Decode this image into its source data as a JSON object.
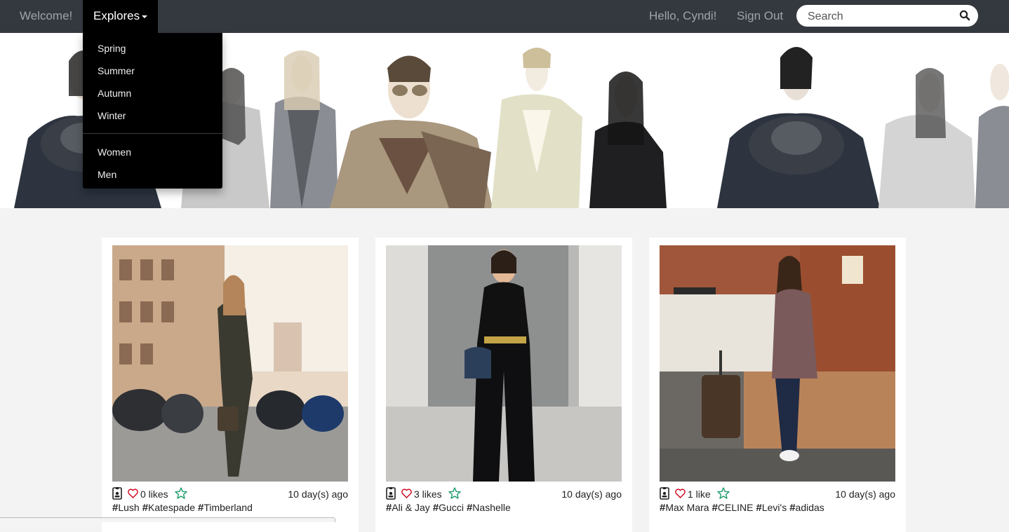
{
  "nav": {
    "welcome": "Welcome!",
    "explores": "Explores",
    "greeting": "Hello, Cyndi!",
    "sign_out": "Sign Out",
    "search_placeholder": "Search"
  },
  "dropdown": {
    "seasons": [
      "Spring",
      "Summer",
      "Autumn",
      "Winter"
    ],
    "genders": [
      "Women",
      "Men"
    ]
  },
  "posts": [
    {
      "likes": "0 likes",
      "time": "10 day(s) ago",
      "tags": [
        "Lush",
        "Katespade",
        "Timberland"
      ]
    },
    {
      "likes": "3 likes",
      "time": "10 day(s) ago",
      "tags": [
        "Ali & Jay",
        "Gucci",
        "Nashelle"
      ]
    },
    {
      "likes": "1 like",
      "time": "10 day(s) ago",
      "tags": [
        "Max Mara",
        "CELINE",
        "Levi's",
        "adidas"
      ]
    }
  ],
  "icons": {
    "profile": "id-badge-icon",
    "like": "heart-icon",
    "favorite": "star-icon",
    "search": "search-icon"
  },
  "colors": {
    "navbar": "#34393f",
    "dropdown": "#000000",
    "heart": "#d0021b",
    "star": "#1a9c6a",
    "page_bg": "#f3f3f3"
  }
}
